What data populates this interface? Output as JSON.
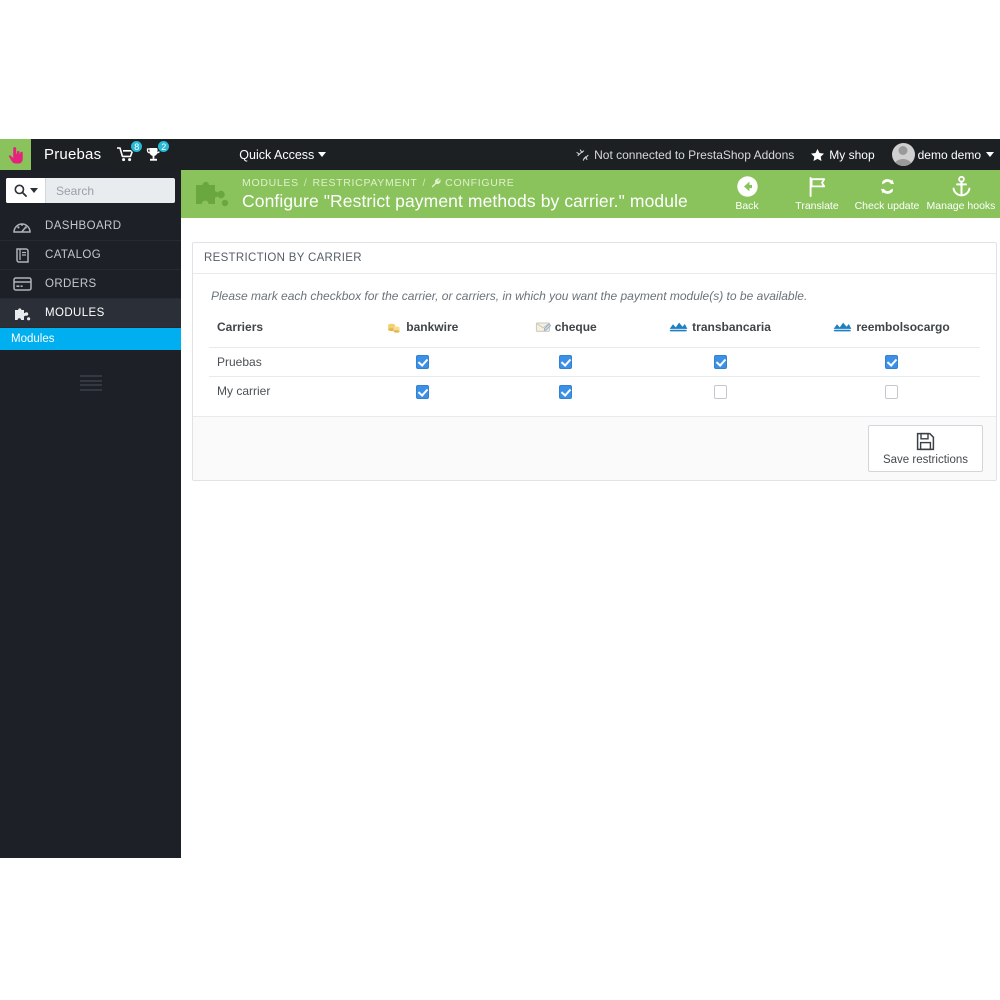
{
  "topbar": {
    "logo_icon": "hand-pointer-icon",
    "shop_name": "Pruebas",
    "cart_icon": "cart-icon",
    "cart_badge": "8",
    "trophy_icon": "trophy-icon",
    "trophy_badge": "2",
    "quick_access_label": "Quick Access",
    "addons_icon": "addons-icon",
    "addons_label": "Not connected to PrestaShop Addons",
    "star_icon": "star-icon",
    "my_shop_label": "My shop",
    "avatar_icon": "avatar",
    "user_name": "demo demo"
  },
  "sidebar": {
    "search": {
      "placeholder": "Search",
      "value": "",
      "icon": "search-icon"
    },
    "items": [
      {
        "label": "DASHBOARD",
        "icon": "dashboard-icon",
        "active": false
      },
      {
        "label": "CATALOG",
        "icon": "catalog-icon",
        "active": false
      },
      {
        "label": "ORDERS",
        "icon": "orders-icon",
        "active": false
      },
      {
        "label": "MODULES",
        "icon": "modules-icon",
        "active": true
      }
    ],
    "submenu": [
      {
        "label": "Modules",
        "active": true
      }
    ],
    "collapse_icon": "collapse-menu-icon"
  },
  "page_header": {
    "icon": "puzzle-piece-icon",
    "breadcrumb": {
      "root": "MODULES",
      "section": "RESTRICPAYMENT",
      "current": "CONFIGURE",
      "current_icon": "wrench-icon",
      "separator": "/"
    },
    "title": "Configure \"Restrict payment methods by carrier.\" module",
    "tools": [
      {
        "label": "Back",
        "icon": "back-arrow-icon"
      },
      {
        "label": "Translate",
        "icon": "flag-icon"
      },
      {
        "label": "Check update",
        "icon": "refresh-icon"
      },
      {
        "label": "Manage hooks",
        "icon": "anchor-icon"
      }
    ]
  },
  "panel": {
    "heading": "RESTRICTION BY CARRIER",
    "hint": "Please mark each checkbox for the carrier, or carriers, in which you want the payment module(s) to be available.",
    "columns": [
      {
        "label": "Carriers",
        "icon": ""
      },
      {
        "label": "bankwire",
        "icon": "coins-icon"
      },
      {
        "label": "cheque",
        "icon": "cheque-icon"
      },
      {
        "label": "transbancaria",
        "icon": "transbancaria-icon"
      },
      {
        "label": "reembolsocargo",
        "icon": "reembolsocargo-icon"
      }
    ],
    "rows": [
      {
        "carrier": "Pruebas",
        "checks": [
          true,
          true,
          true,
          true
        ]
      },
      {
        "carrier": "My carrier",
        "checks": [
          true,
          true,
          false,
          false
        ]
      }
    ],
    "save_label": "Save restrictions",
    "save_icon": "floppy-disk-icon"
  },
  "colors": {
    "brand_green": "#8ac35c",
    "topbar_dark": "#1d2023",
    "sidebar_dark": "#1d2127",
    "submenu_blue": "#00aff0",
    "checkbox_blue": "#3c91e6",
    "badge_cyan": "#25b9d7"
  }
}
